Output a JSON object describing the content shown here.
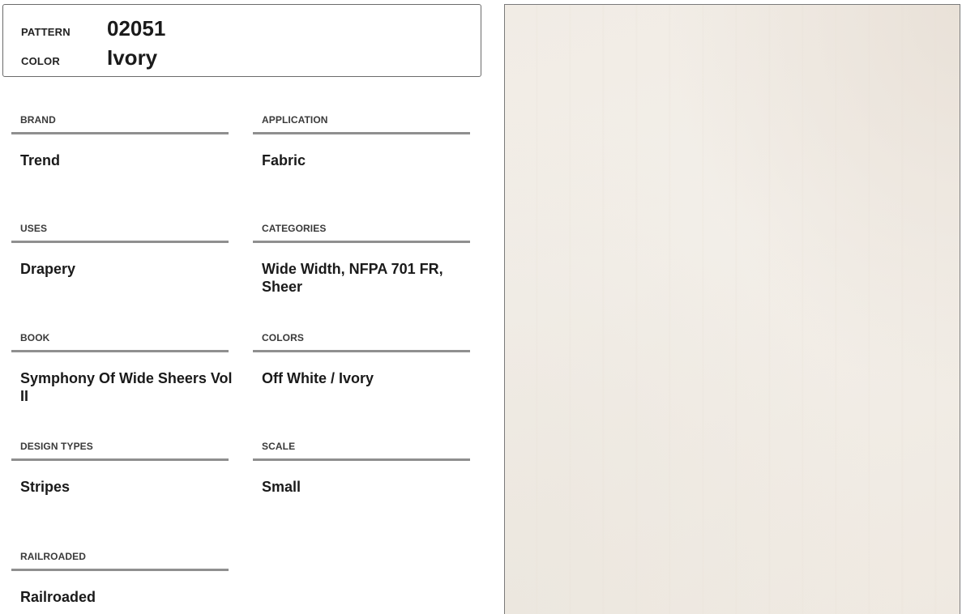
{
  "header": {
    "pattern_label": "PATTERN",
    "pattern_value": "02051",
    "color_label": "COLOR",
    "color_value": "Ivory"
  },
  "specs": {
    "brand": {
      "label": "BRAND",
      "value": "Trend"
    },
    "application": {
      "label": "APPLICATION",
      "value": "Fabric"
    },
    "uses": {
      "label": "USES",
      "value": "Drapery"
    },
    "categories": {
      "label": "CATEGORIES",
      "value": "Wide Width, NFPA 701 FR, Sheer"
    },
    "book": {
      "label": "BOOK",
      "value": "Symphony Of Wide Sheers Vol II"
    },
    "colors": {
      "label": "COLORS",
      "value": "Off White / Ivory"
    },
    "design_types": {
      "label": "DESIGN TYPES",
      "value": "Stripes"
    },
    "scale": {
      "label": "SCALE",
      "value": "Small"
    },
    "railroaded": {
      "label": "RAILROADED",
      "value": "Railroaded"
    }
  },
  "colors": {
    "rule": "#8f8f8f",
    "swatch": "#f1ece5"
  }
}
